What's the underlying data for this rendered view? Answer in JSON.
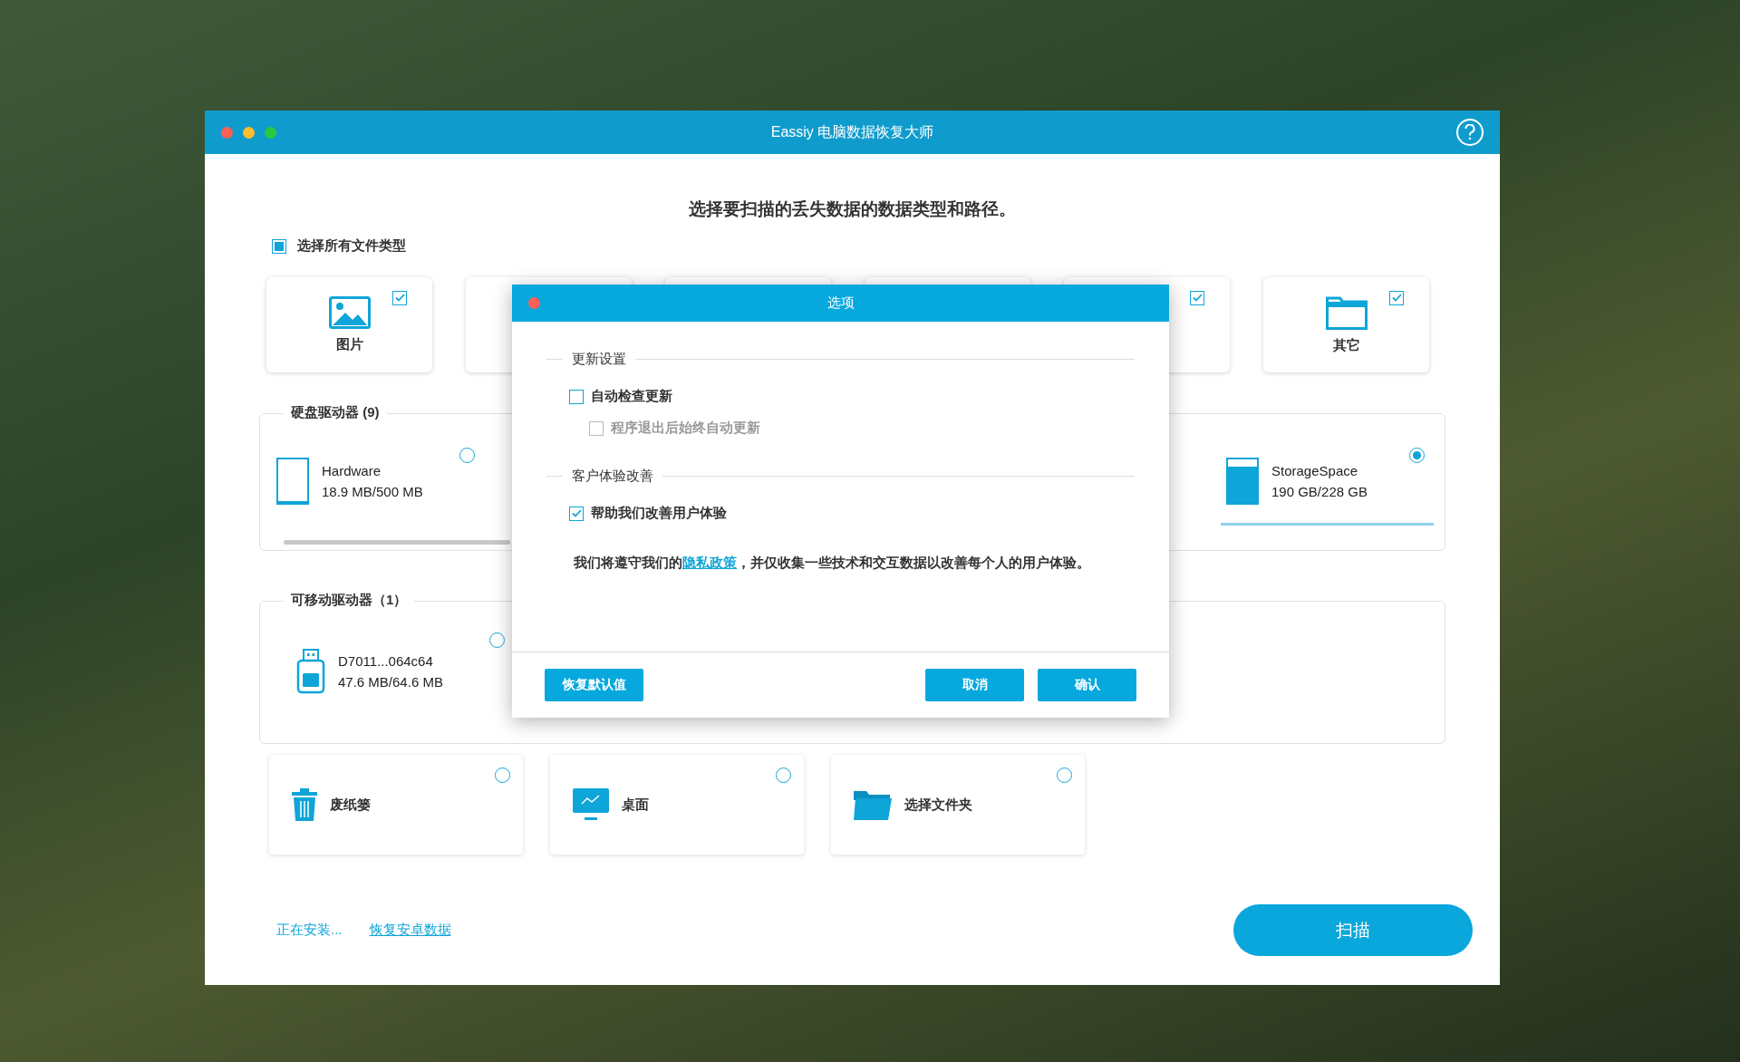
{
  "window": {
    "title": "Eassiy 电脑数据恢复大师"
  },
  "heading": "选择要扫描的丢失数据的数据类型和路径。",
  "select_all": {
    "label": "选择所有文件类型",
    "checked": true
  },
  "file_types": [
    {
      "kind": "image",
      "label": "图片",
      "checked": true
    },
    {
      "kind": "covered"
    },
    {
      "kind": "covered"
    },
    {
      "kind": "covered"
    },
    {
      "kind": "covered",
      "checked": true
    },
    {
      "kind": "folder",
      "label": "其它",
      "checked": true
    }
  ],
  "hard_drives": {
    "title": "硬盘驱动器 (9)",
    "items": [
      {
        "name": "Hardware",
        "size": "18.9 MB/500 MB",
        "level": 0.04,
        "selected": false
      },
      {
        "name": "StorageSpace",
        "size": "190 GB/228 GB",
        "level": 0.83,
        "selected": true
      }
    ]
  },
  "removable_drives": {
    "title": "可移动驱动器（1）",
    "items": [
      {
        "name": "D7011...064c64",
        "size": "47.6 MB/64.6 MB",
        "selected": false
      }
    ]
  },
  "locations": [
    {
      "kind": "trash",
      "label": "废纸篓",
      "selected": false
    },
    {
      "kind": "desktop",
      "label": "桌面",
      "selected": false
    },
    {
      "kind": "folder",
      "label": "选择文件夹",
      "selected": false
    }
  ],
  "footer": {
    "status": "正在安装...",
    "link": "恢复安卓数据",
    "scan_button": "扫描"
  },
  "dialog": {
    "title": "选项",
    "sections": [
      {
        "title": "更新设置",
        "options": [
          {
            "label": "自动检查更新",
            "checked": false,
            "disabled": false,
            "children": [
              {
                "label": "程序退出后始终自动更新",
                "checked": false,
                "disabled": true
              }
            ]
          }
        ]
      },
      {
        "title": "客户体验改善",
        "options": [
          {
            "label": "帮助我们改善用户体验",
            "checked": true,
            "disabled": false
          }
        ]
      }
    ],
    "note": {
      "before": "我们将遵守我们的",
      "link": "隐私政策",
      "after": "，并仅收集一些技术和交互数据以改善每个人的用户体验。"
    },
    "buttons": {
      "reset": "恢复默认值",
      "cancel": "取消",
      "confirm": "确认"
    }
  }
}
